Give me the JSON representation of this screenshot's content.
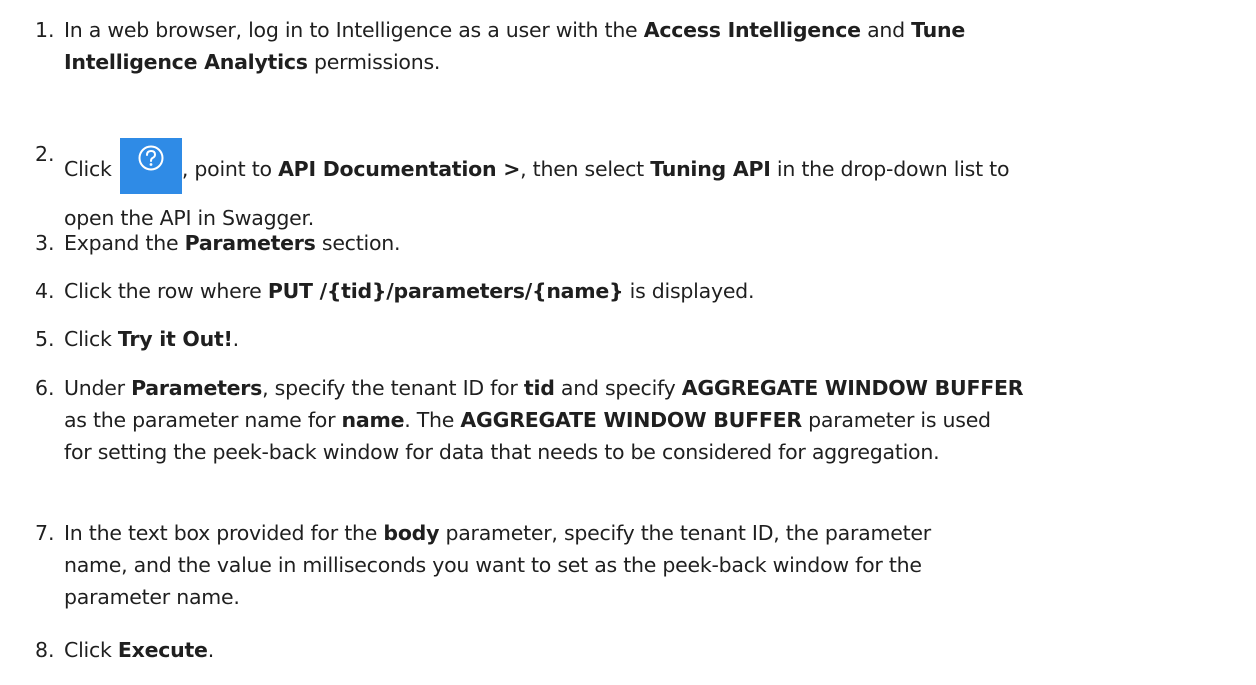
{
  "steps": [
    {
      "number": "1.",
      "lines": [
        [
          {
            "t": "In a web browser, log in to Intelligence as a user with the "
          },
          {
            "t": "Access Intelligence",
            "b": true
          },
          {
            "t": " and "
          },
          {
            "t": "Tune",
            "b": true
          }
        ],
        [
          {
            "t": "Intelligence Analytics",
            "b": true
          },
          {
            "t": " permissions."
          }
        ]
      ]
    },
    {
      "number": "2.",
      "lines": [
        [
          {
            "t": "Click "
          },
          {
            "icon": "help-icon"
          },
          {
            "t": ", point to "
          },
          {
            "t": "API Documentation >",
            "b": true
          },
          {
            "t": ", then select "
          },
          {
            "t": "Tuning API",
            "b": true
          },
          {
            "t": " in the drop-down list to"
          }
        ],
        [
          {
            "t": "open the API in Swagger."
          }
        ]
      ]
    },
    {
      "number": "3.",
      "lines": [
        [
          {
            "t": "Expand the "
          },
          {
            "t": "Parameters",
            "b": true
          },
          {
            "t": " section."
          }
        ]
      ]
    },
    {
      "number": "4.",
      "lines": [
        [
          {
            "t": "Click the row where "
          },
          {
            "t": "PUT /{tid}/parameters/{name}",
            "b": true
          },
          {
            "t": " is displayed."
          }
        ]
      ]
    },
    {
      "number": "5.",
      "lines": [
        [
          {
            "t": "Click "
          },
          {
            "t": "Try it Out!",
            "b": true
          },
          {
            "t": "."
          }
        ]
      ]
    },
    {
      "number": "6.",
      "lines": [
        [
          {
            "t": "Under "
          },
          {
            "t": "Parameters",
            "b": true
          },
          {
            "t": ", specify the tenant ID for "
          },
          {
            "t": "tid",
            "b": true
          },
          {
            "t": " and specify "
          },
          {
            "t": "AGGREGATE WINDOW BUFFER",
            "b": true
          }
        ],
        [
          {
            "t": "as the parameter name for "
          },
          {
            "t": "name",
            "b": true
          },
          {
            "t": ". The "
          },
          {
            "t": "AGGREGATE WINDOW BUFFER",
            "b": true
          },
          {
            "t": " parameter is used"
          }
        ],
        [
          {
            "t": "for setting the peek-back window for data that needs to be considered for aggregation."
          }
        ]
      ]
    },
    {
      "number": "7.",
      "lines": [
        [
          {
            "t": "In the text box provided for the "
          },
          {
            "t": "body",
            "b": true
          },
          {
            "t": " parameter, specify the tenant ID, the parameter"
          }
        ],
        [
          {
            "t": "name, and the value in milliseconds you want to set as the peek-back window for the"
          }
        ],
        [
          {
            "t": "parameter name."
          }
        ]
      ]
    },
    {
      "number": "8.",
      "lines": [
        [
          {
            "t": "Click "
          },
          {
            "t": "Execute",
            "b": true
          },
          {
            "t": "."
          }
        ]
      ]
    }
  ],
  "colors": {
    "text": "#1f1f1f",
    "help_button_bg": "#2f8be6",
    "help_icon": "#ffffff"
  }
}
